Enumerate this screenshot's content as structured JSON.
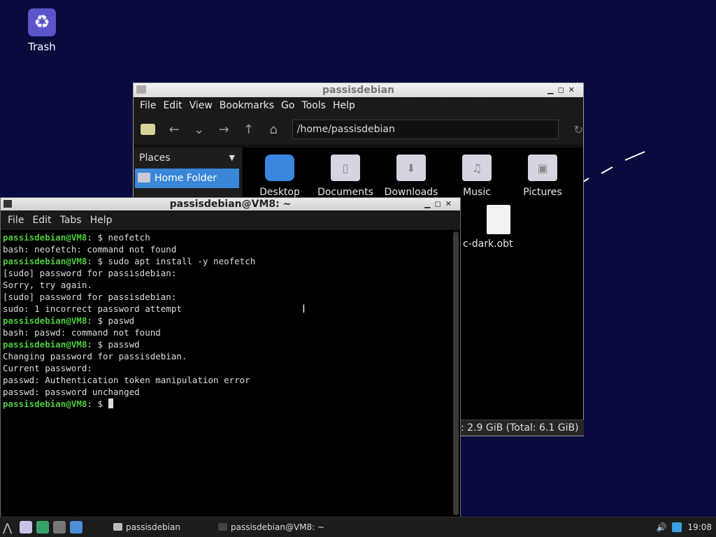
{
  "desktop": {
    "trash_label": "Trash"
  },
  "file_manager": {
    "title": "passisdebian",
    "menu": [
      "File",
      "Edit",
      "View",
      "Bookmarks",
      "Go",
      "Tools",
      "Help"
    ],
    "location": "/home/passisdebian",
    "places_label": "Places",
    "home_folder": "Home Folder",
    "folders": [
      "Desktop",
      "Documents",
      "Downloads",
      "Music",
      "Pictures"
    ],
    "file_name": "c-dark.obt",
    "status": ": 2.9 GiB (Total: 6.1 GiB)"
  },
  "terminal": {
    "title": "passisdebian@VM8: ~",
    "menu": [
      "File",
      "Edit",
      "Tabs",
      "Help"
    ],
    "prompt": "passisdebian@VM8",
    "prompt_suffix": ": $ ",
    "lines": [
      {
        "prompt": true,
        "text": "neofetch"
      },
      {
        "prompt": false,
        "text": "bash: neofetch: command not found"
      },
      {
        "prompt": true,
        "text": "sudo apt install -y neofetch"
      },
      {
        "prompt": false,
        "text": "[sudo] password for passisdebian:"
      },
      {
        "prompt": false,
        "text": "Sorry, try again."
      },
      {
        "prompt": false,
        "text": "[sudo] password for passisdebian:"
      },
      {
        "prompt": false,
        "text": "sudo: 1 incorrect password attempt"
      },
      {
        "prompt": true,
        "text": "paswd"
      },
      {
        "prompt": false,
        "text": "bash: paswd: command not found"
      },
      {
        "prompt": true,
        "text": "passwd"
      },
      {
        "prompt": false,
        "text": "Changing password for passisdebian."
      },
      {
        "prompt": false,
        "text": "Current password:"
      },
      {
        "prompt": false,
        "text": "passwd: Authentication token manipulation error"
      },
      {
        "prompt": false,
        "text": "passwd: password unchanged"
      },
      {
        "prompt": true,
        "text": ""
      }
    ]
  },
  "taskbar": {
    "task_filemanager": "passisdebian",
    "task_terminal": "passisdebian@VM8: ~",
    "clock": "19:08"
  }
}
